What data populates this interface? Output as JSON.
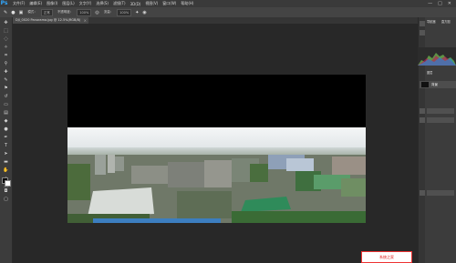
{
  "app": {
    "logo": "Ps"
  },
  "menu": [
    "文件(F)",
    "编辑(E)",
    "图像(I)",
    "图层(L)",
    "文字(Y)",
    "选择(S)",
    "滤镜(T)",
    "3D(D)",
    "视图(V)",
    "窗口(W)",
    "帮助(H)"
  ],
  "window_controls": [
    "—",
    "□",
    "✕"
  ],
  "options_bar": {
    "mode_label": "模式：",
    "mode_value": "正常",
    "opacity_label": "不透明度：",
    "opacity_value": "100%",
    "flow_label": "流量：",
    "flow_value": "100%"
  },
  "document_tab": {
    "title": "DJI_0020 Panorama.jpg @ 12.5%(RGB/8)",
    "close": "×"
  },
  "panels": {
    "histogram_tab": "导航器",
    "histogram_tab2": "直方图",
    "layers_tab": "图层",
    "layer_name": "背景"
  },
  "watermark": "系统之家"
}
